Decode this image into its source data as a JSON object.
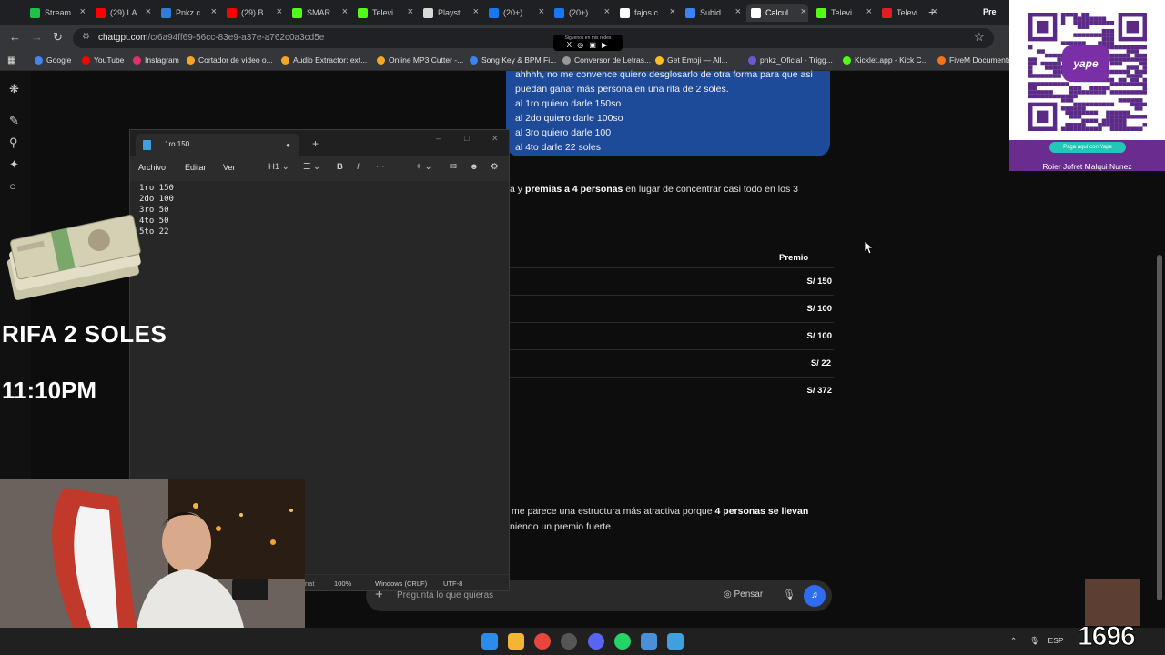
{
  "browser": {
    "tabs": [
      {
        "label": "Stream",
        "color": "#1fc14a"
      },
      {
        "label": "(29) LA",
        "color": "#ff0000"
      },
      {
        "label": "Pnkz c",
        "color": "#2f7fd8"
      },
      {
        "label": "(29) B",
        "color": "#ff0000"
      },
      {
        "label": "SMAR",
        "color": "#53fc18"
      },
      {
        "label": "Televi",
        "color": "#53fc18"
      },
      {
        "label": "Playst",
        "color": "#d8d8d8"
      },
      {
        "label": "(20+)",
        "color": "#1877f2"
      },
      {
        "label": "(20+)",
        "color": "#1877f2"
      },
      {
        "label": "fajos c",
        "color": "#ffffff"
      },
      {
        "label": "Subid",
        "color": "#3b82f6"
      },
      {
        "label": "Calcul",
        "color": "#ffffff"
      },
      {
        "label": "Televi",
        "color": "#53fc18"
      },
      {
        "label": "Televi",
        "color": "#e02020"
      }
    ],
    "active_tab_index": 11,
    "extra_tab_label": "Pre",
    "url_host": "chatgpt.com",
    "url_path": "/c/6a94ff69-56cc-83e9-a37e-a762c0a3cd5e",
    "notification": {
      "caption": "Siguenos en mis redes",
      "icons": "X ◎ ▣ ▶"
    },
    "bookmarks": [
      {
        "label": "Google",
        "color": "#4285f4"
      },
      {
        "label": "YouTube",
        "color": "#ff0000"
      },
      {
        "label": "Instagram",
        "color": "#e1306c"
      },
      {
        "label": "Cortador de video o...",
        "color": "#f5a623"
      },
      {
        "label": "Audio Extractor: ext...",
        "color": "#f5a623"
      },
      {
        "label": "Online MP3 Cutter -...",
        "color": "#f5a623"
      },
      {
        "label": "Song Key & BPM Fi...",
        "color": "#3b82f6"
      },
      {
        "label": "Conversor de Letras...",
        "color": "#999999"
      },
      {
        "label": "Get Emoji — All...",
        "color": "#fbbf24"
      },
      {
        "label": "pnkz_Oficial - Trigg...",
        "color": "#6a5acd"
      },
      {
        "label": "Kicklet.app - Kick C...",
        "color": "#53fc18"
      },
      {
        "label": "FiveM Documentat...",
        "color": "#f97316"
      }
    ]
  },
  "chat": {
    "user_message_lines": [
      "ahhhh, no me convence quiero desglosarlo de otra forma para que asi",
      "puedan ganar más persona en una rifa de 2 soles.",
      "al 1ro quiero darle 150so",
      "al 2do  quiero darle 100so",
      "al 3ro quiero darle 100",
      "al 4to darle 22 soles"
    ],
    "reply_line1_pre": "a y ",
    "reply_line1_bold": "premias a 4 personas",
    "reply_line1_post": " en lugar de concentrar casi todo en los 3",
    "table_header": "Premio",
    "prizes": [
      "S/ 150",
      "S/ 100",
      "S/ 100",
      "S/ 22",
      "S/ 372"
    ],
    "reply_line2_pre": "me parece una estructura más atractiva porque ",
    "reply_line2_bold": "4 personas se llevan",
    "reply_line3": "niendo un premio fuerte.",
    "composer_placeholder": "Pregunta lo que quieras",
    "think_label": "Pensar"
  },
  "notepad": {
    "tab_title": "1ro 150",
    "menu": [
      "Archivo",
      "Editar",
      "Ver"
    ],
    "heading_label": "H1",
    "content": "1ro 150\n2do 100\n3ro 50\n4to 50\n5to 22",
    "status": {
      "partial": "nat",
      "zoom": "100%",
      "line_endings": "Windows (CRLF)",
      "encoding": "UTF-8"
    }
  },
  "overlay": {
    "title": "RIFA 2 SOLES",
    "time": "11:10PM",
    "yape_button": "Paga aquí con Yape",
    "yape_logo": "yape",
    "yape_name": "Roier Jofret Malqui Nunez",
    "counter": "1696"
  },
  "taskbar": {
    "lang": "ESP"
  },
  "colors": {
    "accent_blue": "#1e4a9a",
    "yape_purple": "#6a2c8e"
  }
}
